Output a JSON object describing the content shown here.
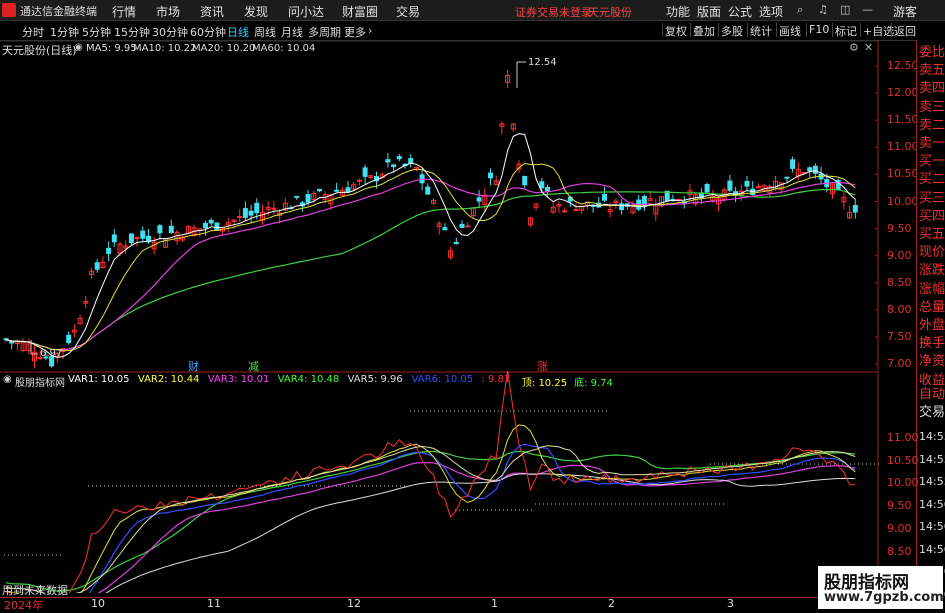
{
  "titlebar": {
    "app": "通达信金融终端",
    "menus": [
      "行情",
      "市场",
      "资讯",
      "发现",
      "问小达",
      "财富圈",
      "交易"
    ],
    "login_hint": "证券交易未登录",
    "stock_name": "天元股份",
    "right": [
      "功能",
      "版面",
      "公式",
      "选项"
    ],
    "guest": "游客"
  },
  "toolbar": {
    "periods": [
      "分时",
      "1分钟",
      "5分钟",
      "15分钟",
      "30分钟",
      "60分钟",
      "日线",
      "周线",
      "月线",
      "多周期",
      "更多"
    ],
    "active": "日线",
    "buttons": [
      "复权",
      "叠加",
      "多股",
      "统计",
      "画线",
      "F10",
      "标记",
      "+自选",
      "返回"
    ]
  },
  "main": {
    "title": "天元股份(日线)",
    "ma": [
      {
        "l": "MA5: 9.95",
        "c": "#ffffff"
      },
      {
        "l": "MA10: 10.22",
        "c": "#ffff40"
      },
      {
        "l": "MA20: 10.20",
        "c": "#ff40ff"
      },
      {
        "l": "MA60: 10.04",
        "c": "#40ff40"
      }
    ],
    "high_label": "12.54",
    "low_label": "6.97",
    "yticks": [
      "12.50",
      "12.00",
      "11.50",
      "11.00",
      "10.50",
      "10.00",
      "9.50",
      "9.00",
      "8.50",
      "8.00",
      "7.50",
      "7.00"
    ],
    "markers": [
      {
        "t": "财",
        "c": "#4aa0ff"
      },
      {
        "t": "减",
        "c": "#4ade4a"
      },
      {
        "t": "涨",
        "c": "#ff3030"
      }
    ]
  },
  "side_labels": [
    "委比",
    "卖五",
    "卖四",
    "卖三",
    "卖二",
    "卖一",
    "买一",
    "买二",
    "买三",
    "买四",
    "买五",
    "现价",
    "涨跌",
    "涨幅",
    "总量",
    "外盘",
    "换手",
    "净资",
    "收益"
  ],
  "side_extra": [
    "自动",
    "交易"
  ],
  "side_times": [
    "14:55",
    "14:55",
    "14:55",
    "14:56",
    "14:56",
    "14:56",
    "14:56",
    "14:56"
  ],
  "indicator": {
    "name": "股朋指标网",
    "vars": [
      {
        "l": "VAR1: 10.05",
        "c": "#ffffff"
      },
      {
        "l": "VAR2: 10.44",
        "c": "#ffff40"
      },
      {
        "l": "VAR3: 10.01",
        "c": "#ff40ff"
      },
      {
        "l": "VAR4: 10.48",
        "c": "#40ff40"
      },
      {
        "l": "VAR5: 9.96",
        "c": "#dddddd"
      },
      {
        "l": "VAR6: 10.05",
        "c": "#3050ff"
      },
      {
        "l": ": 9.81",
        "c": "#ff3030"
      },
      {
        "l": "顶: 10.25",
        "c": "#ffff40"
      },
      {
        "l": "底: 9.74",
        "c": "#40ff40"
      }
    ],
    "yticks": [
      "11.00",
      "10.50",
      "10.00",
      "9.50",
      "9.00",
      "8.50",
      "8.00"
    ],
    "note": "用到未来数据"
  },
  "timeline": {
    "labels": [
      "2024年",
      "10",
      "11",
      "12",
      "1",
      "2",
      "3"
    ]
  },
  "watermark": {
    "line1": "股朋指标网",
    "line2": "www.7gpzb.com"
  }
}
